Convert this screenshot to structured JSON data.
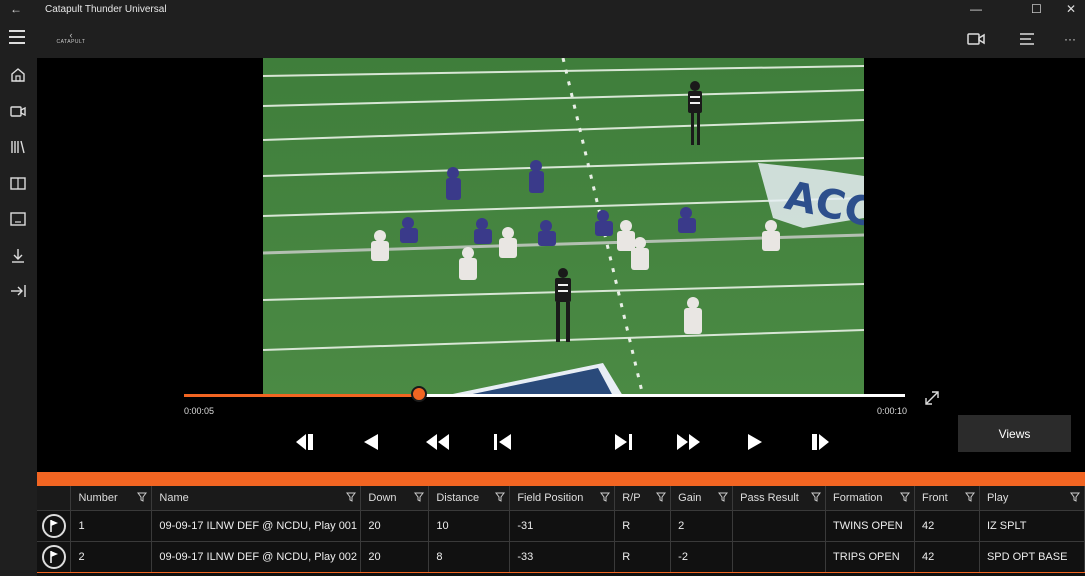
{
  "window": {
    "title": "Catapult Thunder Universal",
    "back_glyph": "←",
    "minimize_glyph": "—",
    "maximize_glyph": "☐",
    "close_glyph": "✕"
  },
  "toolbar": {
    "logo_text": "CATAPULT",
    "more_glyph": "···",
    "icons": [
      "hamburger-icon",
      "video-camera-icon",
      "list-icon",
      "more-icon"
    ]
  },
  "sidebar": {
    "items": [
      "home-icon",
      "video-icon",
      "library-icon",
      "book-icon",
      "tablet-icon",
      "download-icon",
      "collapse-icon"
    ]
  },
  "player": {
    "time_current": "0:00:05",
    "time_total": "0:00:10",
    "progress": 0.326,
    "views_label": "Views",
    "accent": "#f26522",
    "controls": [
      "step-back-frame-icon",
      "play-reverse-icon",
      "rewind-icon",
      "skip-previous-icon",
      "skip-next-icon",
      "fast-forward-icon",
      "play-icon",
      "step-forward-frame-icon"
    ]
  },
  "table": {
    "columns": [
      "",
      "Number",
      "Name",
      "Down",
      "Distance",
      "Field Position",
      "R/P",
      "Gain",
      "Pass Result",
      "Formation",
      "Front",
      "Play"
    ],
    "rows": [
      [
        "",
        "1",
        "09-09-17 ILNW DEF @ NCDU, Play 001",
        "20",
        "10",
        "-31",
        "R",
        "2",
        "",
        "TWINS OPEN",
        "42",
        "IZ SPLT"
      ],
      [
        "",
        "2",
        "09-09-17 ILNW DEF @ NCDU, Play 002",
        "20",
        "8",
        "-33",
        "R",
        "-2",
        "",
        "TRIPS OPEN",
        "42",
        "SPD OPT BASE"
      ]
    ]
  }
}
